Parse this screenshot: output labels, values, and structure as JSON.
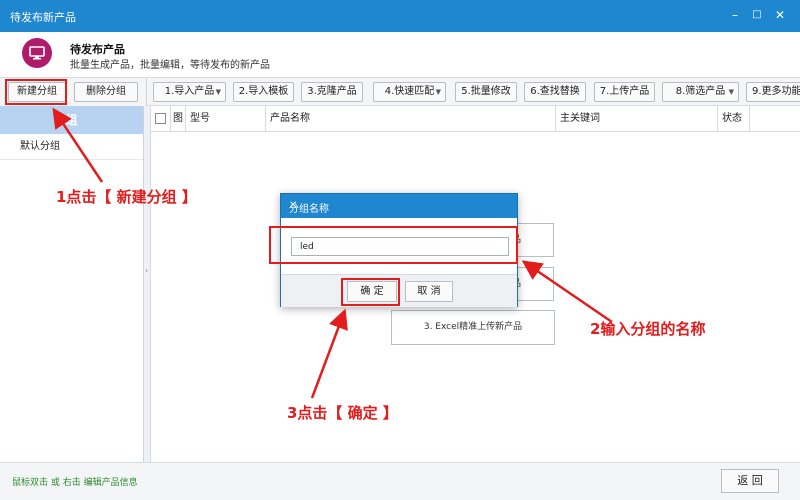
{
  "window": {
    "title": "待发布新产品",
    "minimize": "–",
    "maximize": "□",
    "close": "✕"
  },
  "header": {
    "title": "待发布产品",
    "description": "批量生成产品，批量编辑，等待发布的新产品",
    "icon": "monitor-icon",
    "icon_color": "#b11b6c"
  },
  "left_toolbar": {
    "new_group": "新建分组",
    "delete_group": "删除分组"
  },
  "main_toolbar": {
    "buttons": [
      {
        "label": "1.导入产品",
        "dropdown": true
      },
      {
        "label": "2.导入模板",
        "dropdown": false
      },
      {
        "label": "3.克隆产品",
        "dropdown": false
      },
      {
        "label": "4.快速匹配",
        "dropdown": true
      },
      {
        "label": "5.批量修改",
        "dropdown": false
      },
      {
        "label": "6.查找替换",
        "dropdown": false
      },
      {
        "label": "7.上传产品",
        "dropdown": false
      },
      {
        "label": "8.筛选产品",
        "dropdown": true
      },
      {
        "label": "9.更多功能",
        "dropdown": false
      }
    ]
  },
  "sidebar": {
    "header": "组",
    "items": [
      "默认分组"
    ]
  },
  "table": {
    "columns": [
      "图",
      "型号",
      "产品名称",
      "主关键词",
      "状态"
    ]
  },
  "center_buttons": {
    "b1_partial": "品",
    "b2_partial": "品",
    "b3": "3. Excel精准上传新产品"
  },
  "dialog": {
    "title": "分组名称",
    "close": "✕",
    "input_value": "led",
    "ok": "确 定",
    "cancel": "取 消"
  },
  "annotations": {
    "step1": "1点击【 新建分组 】",
    "step2": "2输入分组的名称",
    "step3": "3点击【 确定 】",
    "color": "#e31c1c"
  },
  "statusbar": {
    "hint": "鼠标双击 或 右击 编辑产品信息",
    "back": "返 回"
  },
  "colors": {
    "titlebar": "#1f86d0",
    "sidebar_header": "#b8d3f2",
    "hint_text": "#2a8a2a"
  }
}
